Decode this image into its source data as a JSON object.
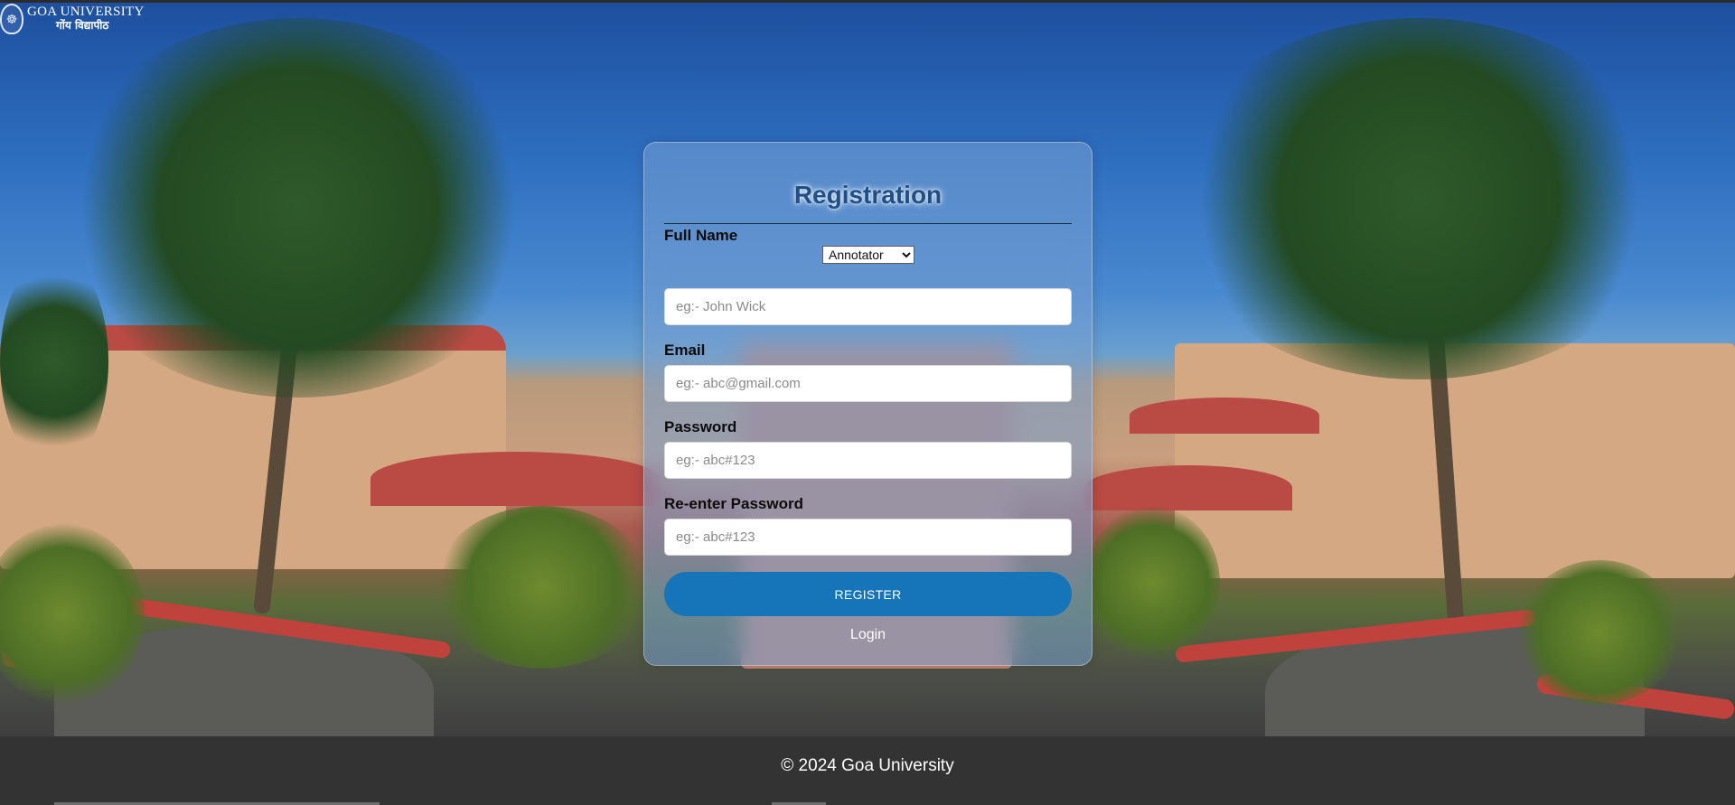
{
  "header": {
    "logo_title": "GOA UNIVERSITY",
    "logo_subtitle": "गोंय विद्यापीठ",
    "emblem_icon": "university-emblem-icon"
  },
  "registration": {
    "title": "Registration",
    "role_select": {
      "selected": "Annotator",
      "options": [
        "Annotator"
      ]
    },
    "fields": {
      "full_name": {
        "label": "Full Name",
        "placeholder": "eg:- John Wick",
        "value": ""
      },
      "email": {
        "label": "Email",
        "placeholder": "eg:- abc@gmail.com",
        "value": ""
      },
      "password": {
        "label": "Password",
        "placeholder": "eg:- abc#123",
        "value": ""
      },
      "reenter_password": {
        "label": "Re-enter Password",
        "placeholder": "eg:- abc#123",
        "value": ""
      }
    },
    "register_label": "REGISTER",
    "login_label": "Login"
  },
  "footer": {
    "copyright": "© 2024 Goa University"
  },
  "colors": {
    "accent": "#1674b8",
    "title": "#1f4f86",
    "footer_bg": "#333333"
  }
}
